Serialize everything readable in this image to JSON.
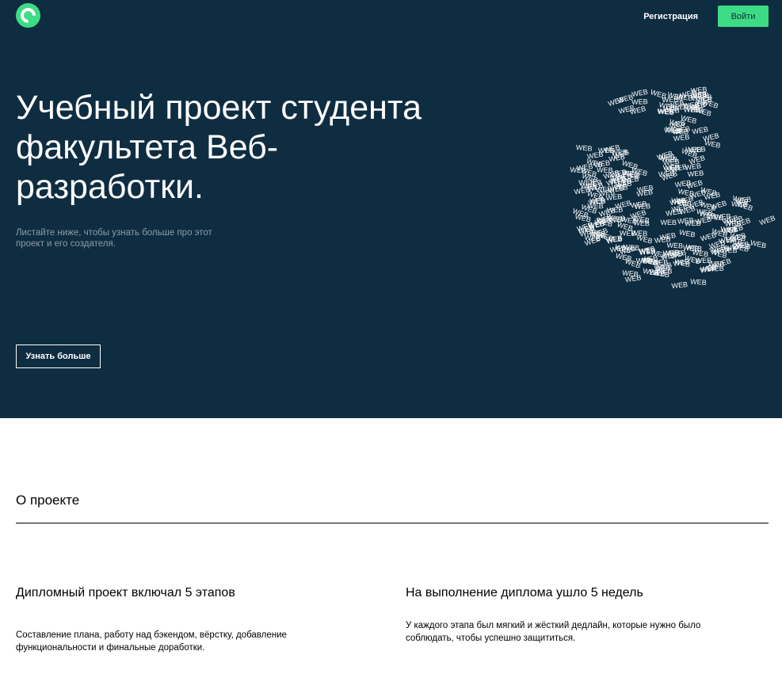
{
  "header": {
    "logo_icon": "c-logo-icon",
    "register_label": "Регистрация",
    "login_label": "Войти"
  },
  "hero": {
    "title": "Учебный проект студента факультета Веб-разработки.",
    "subtitle": "Листайте ниже, чтобы узнать больше про этот проект и его создателя.",
    "more_label": "Узнать больше",
    "globe_word": "WEB"
  },
  "about": {
    "section_title": "О проекте",
    "stages_title": "Дипломный проект включал 5 этапов",
    "stages_text": "Составление плана, работу над бэкендом, вёрстку, добавление функциональности и финальные доработки.",
    "weeks_title": "На выполнение диплома ушло 5 недель",
    "weeks_text": "У каждого этапа был мягкий и жёсткий дедлайн, которые нужно было соблюдать, чтобы успешно защититься."
  },
  "colors": {
    "hero_bg": "#0f2d41",
    "accent": "#3ddc84",
    "muted_text": "#8d9ca6"
  }
}
